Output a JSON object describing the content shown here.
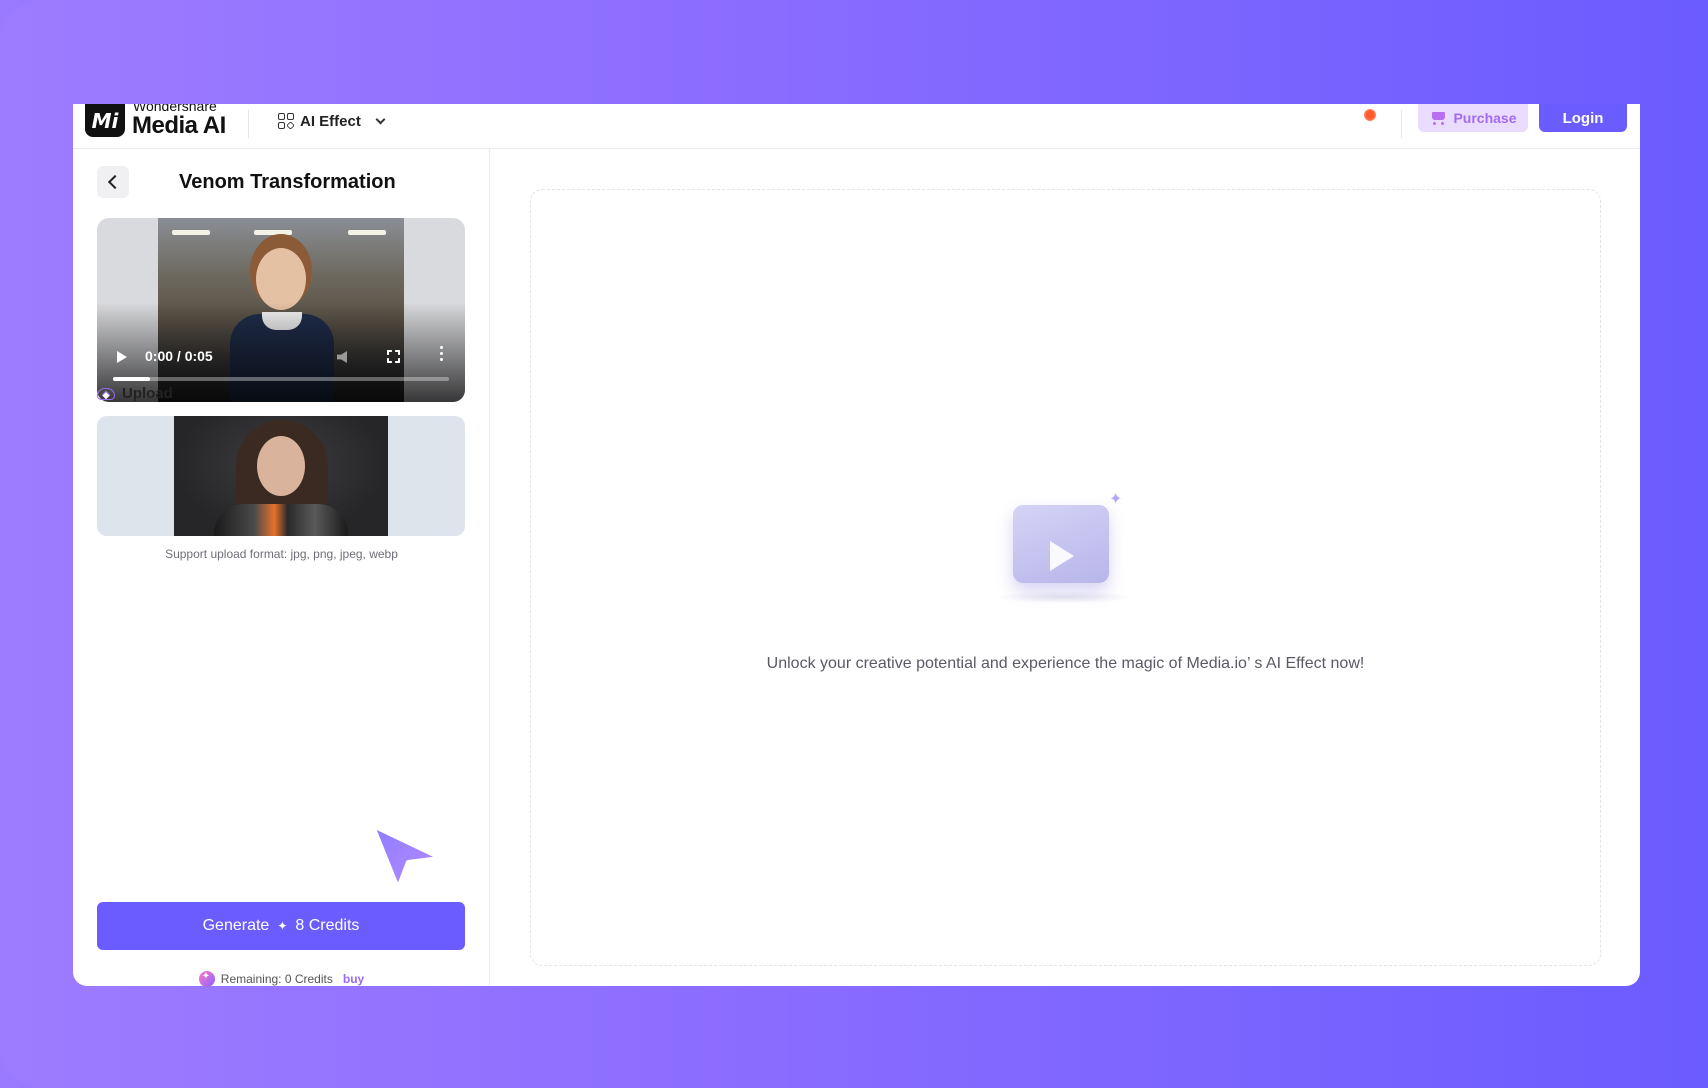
{
  "header": {
    "brand_small": "Wondershare",
    "brand_big": "Media AI",
    "logo_text": "Mi",
    "menu_label": "AI Effect",
    "purchase_label": "Purchase",
    "login_label": "Login"
  },
  "left_panel": {
    "title": "Venom Transformation",
    "video": {
      "time": "0:00 / 0:05",
      "progress_fraction": 0.11
    },
    "upload_label": "Upload",
    "format_note": "Support upload format: jpg, png, jpeg, webp",
    "generate_label": "Generate",
    "generate_credits": "8 Credits",
    "remaining_text": "Remaining: 0 Credits",
    "buy_label": "buy"
  },
  "result": {
    "empty_message": "Unlock your creative potential and experience the magic of Media.io’ s AI Effect now!"
  },
  "colors": {
    "accent": "#6b5cff",
    "purchase_bg": "#eadcff",
    "purchase_text": "#a36cf0",
    "background_gradient_start": "#9e7cff",
    "background_gradient_end": "#6b5cff"
  }
}
